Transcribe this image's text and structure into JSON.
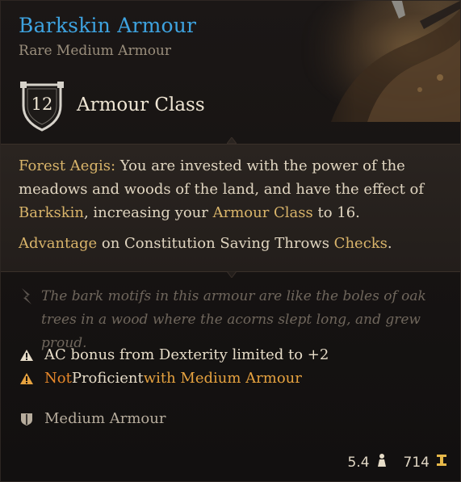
{
  "item": {
    "name": "Barkskin Armour",
    "rarity_type": "Rare Medium Armour"
  },
  "armour_class": {
    "value": "12",
    "label": "Armour Class"
  },
  "description": {
    "passive_name": "Forest Aegis:",
    "line1_a": " You are invested with the power of the meadows and woods of the land, and have the effect of ",
    "barkskin": "Barkskin",
    "line1_b": ", increasing your ",
    "armour_class_link": "Armour Class",
    "line1_c": " to 16.",
    "advantage": "Advantage",
    "line2_a": " on Constitution Saving Throws ",
    "checks": "Checks",
    "line2_b": "."
  },
  "flavor": "The bark motifs in this armour are like the boles of oak trees in a wood where the acorns slept long, and grew proud.",
  "properties": {
    "dex_limit": "AC bonus from Dexterity limited to +2",
    "not": "Not",
    "proficient": " Proficient",
    "with_medium": " with Medium Armour",
    "armour_type": "Medium Armour"
  },
  "footer": {
    "weight": "5.4",
    "value": "714"
  },
  "colors": {
    "title": "#3ea3e0",
    "highlight": "#d9b46a",
    "warning": "#e6872a"
  },
  "icons": {
    "shield": "shield-icon",
    "flavor": "quill-icon",
    "warning": "warning-icon",
    "armour": "armour-type-icon",
    "weight": "weight-icon",
    "gold": "gold-icon"
  }
}
